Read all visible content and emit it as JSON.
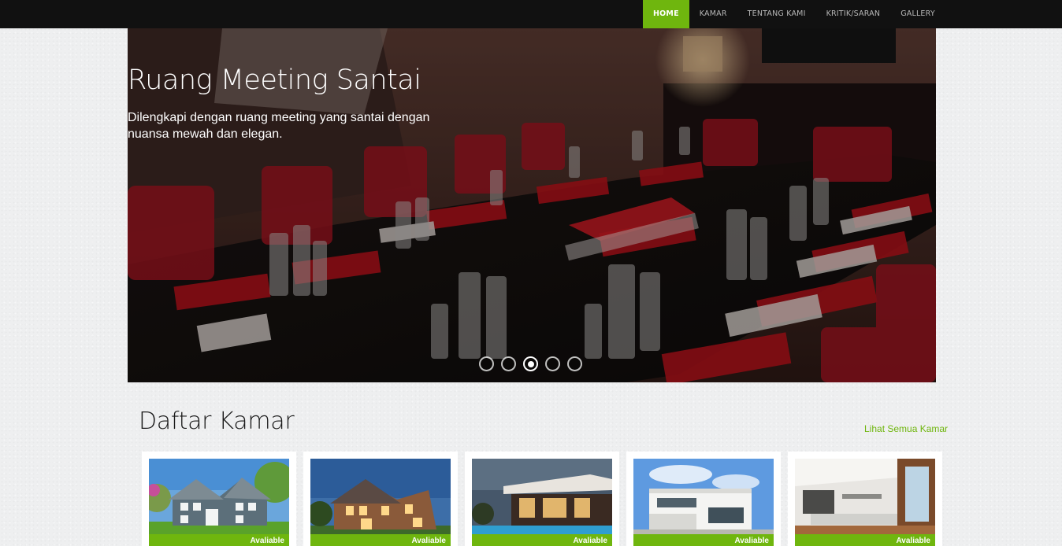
{
  "nav": {
    "items": [
      {
        "label": "HOME",
        "active": true
      },
      {
        "label": "KAMAR",
        "active": false
      },
      {
        "label": "TENTANG KAMI",
        "active": false
      },
      {
        "label": "KRITIK/SARAN",
        "active": false
      },
      {
        "label": "GALLERY",
        "active": false
      }
    ],
    "accent_color": "#6fb60e"
  },
  "hero": {
    "title": "Ruang Meeting Santai",
    "description": "Dilengkapi dengan ruang meeting yang santai dengan nuansa mewah dan elegan.",
    "slide_count": 5,
    "active_slide": 3
  },
  "section": {
    "title": "Daftar Kamar",
    "see_all_label": "Lihat Semua Kamar"
  },
  "rooms": [
    {
      "status": "Avaliable",
      "image": "house-gable-daytime"
    },
    {
      "status": "Avaliable",
      "image": "house-brick-dusk"
    },
    {
      "status": "Avaliable",
      "image": "villa-pool-night"
    },
    {
      "status": "Avaliable",
      "image": "modern-white-villa"
    },
    {
      "status": "Avaliable",
      "image": "interior-kitchen"
    }
  ]
}
